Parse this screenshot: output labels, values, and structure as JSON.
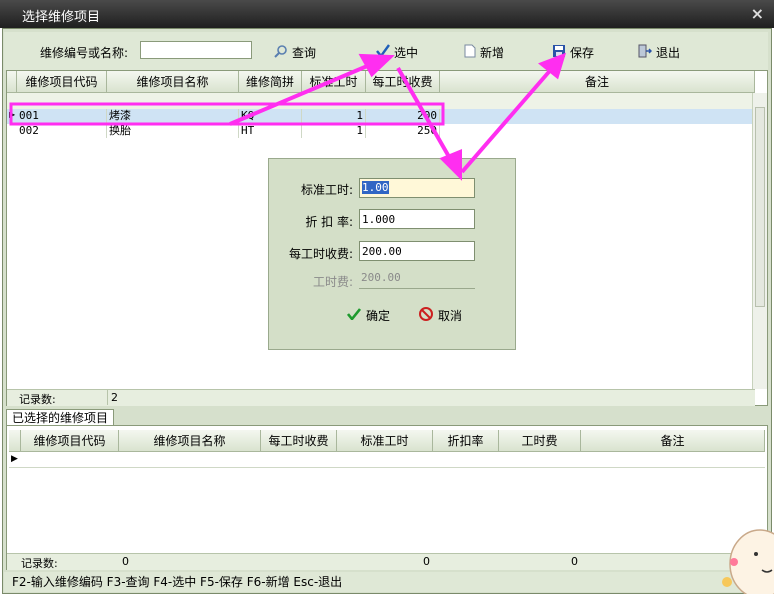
{
  "window": {
    "title": "选择维修项目",
    "close": "×"
  },
  "toolbar": {
    "search_label": "维修编号或名称:",
    "search_value": "",
    "query": "查询",
    "select": "选中",
    "add": "新增",
    "save": "保存",
    "exit": "退出"
  },
  "grid": {
    "headers": [
      "维修项目代码",
      "维修项目名称",
      "维修简拼",
      "标准工时",
      "每工时收费",
      "备注"
    ],
    "rows": [
      {
        "code": "001",
        "name": "烤漆",
        "abbr": "KQ",
        "std_hours": "1",
        "fee": "200"
      },
      {
        "code": "002",
        "name": "换胎",
        "abbr": "HT",
        "std_hours": "1",
        "fee": "250"
      }
    ],
    "count_label": "记录数:",
    "count": "2"
  },
  "dialog": {
    "std_hours_label": "标准工时:",
    "std_hours_value": "1.00",
    "discount_label": "折 扣 率:",
    "discount_value": "1.000",
    "fee_label": "每工时收费:",
    "fee_value": "200.00",
    "labor_label": "工时费:",
    "labor_value": "200.00",
    "ok": "确定",
    "cancel": "取消"
  },
  "selected": {
    "tab": "已选择的维修项目",
    "headers": [
      "维修项目代码",
      "维修项目名称",
      "每工时收费",
      "标准工时",
      "折扣率",
      "工时费",
      "备注"
    ],
    "count_label": "记录数:",
    "count": "0",
    "sum_hours": "0",
    "sum_fee": "0"
  },
  "status": "F2-输入维修编码 F3-查询 F4-选中 F5-保存 F6-新增 Esc-退出",
  "colors": {
    "annotation": "#ff2ef0",
    "selected_row": "#cfe3f4",
    "frame": "#d6e0cc"
  }
}
